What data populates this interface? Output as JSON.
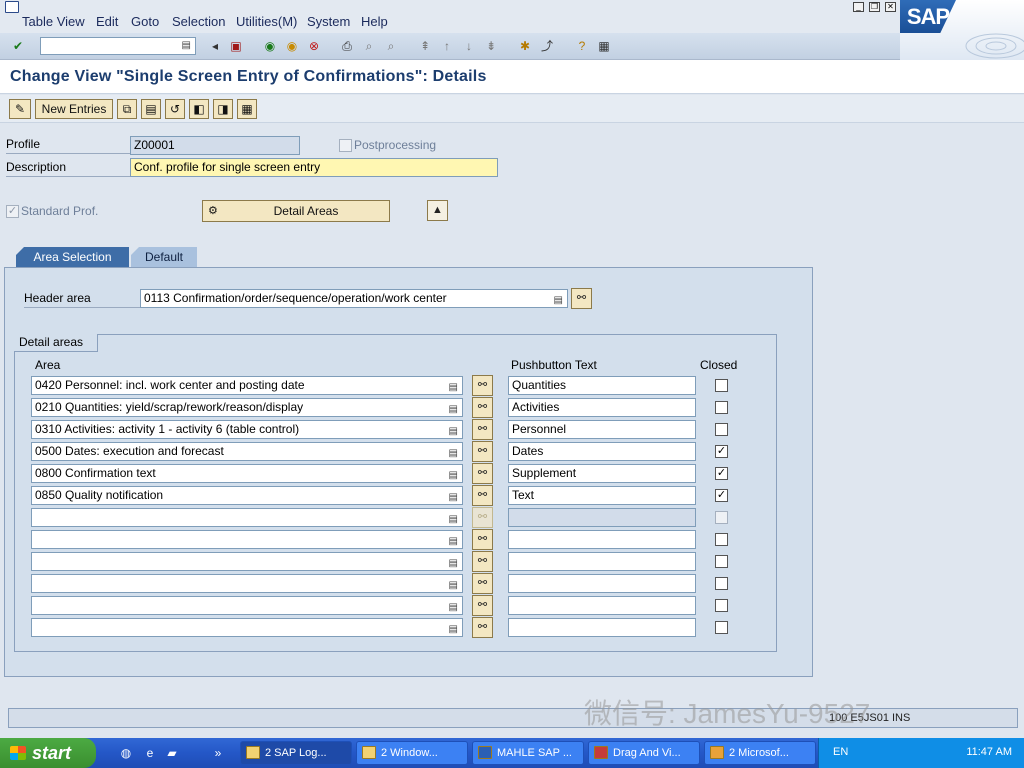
{
  "menu": {
    "items": [
      "Table View",
      "Edit",
      "Goto",
      "Selection",
      "Utilities(M)",
      "System",
      "Help"
    ],
    "underline_first": [
      "T",
      "E",
      "G",
      "S",
      "U",
      "S",
      "H"
    ]
  },
  "logo": {
    "text": "SAP"
  },
  "title": "Change View \"Single Screen Entry of Confirmations\": Details",
  "app_toolbar": {
    "new_entries": "New Entries"
  },
  "form": {
    "profile_label": "Profile",
    "profile_value": "Z00001",
    "postprocessing_label": "Postprocessing",
    "description_label": "Description",
    "description_value": "Conf. profile for single screen entry",
    "standard_prof_label": "Standard Prof.",
    "detail_areas_button": "Detail Areas"
  },
  "tabs": [
    "Area Selection",
    "Default"
  ],
  "header_area": {
    "label": "Header area",
    "value": "0113 Confirmation/order/sequence/operation/work center"
  },
  "detail_areas": {
    "group_title": "Detail areas",
    "columns": {
      "area": "Area",
      "pushbutton_text": "Pushbutton Text",
      "closed": "Closed"
    },
    "rows": [
      {
        "area": "0420 Personnel: incl. work center and posting date",
        "text": "Quantities",
        "closed": false
      },
      {
        "area": "0210 Quantities: yield/scrap/rework/reason/display",
        "text": "Activities",
        "closed": false
      },
      {
        "area": "0310 Activities: activity 1 - activity 6 (table control)",
        "text": "Personnel",
        "closed": false
      },
      {
        "area": "0500 Dates: execution and forecast",
        "text": "Dates",
        "closed": true
      },
      {
        "area": "0800 Confirmation text",
        "text": "Supplement",
        "closed": true
      },
      {
        "area": "0850 Quality notification",
        "text": "Text",
        "closed": true
      },
      {
        "area": "",
        "text": "",
        "closed": false,
        "disabled": true
      },
      {
        "area": "",
        "text": "",
        "closed": false
      },
      {
        "area": "",
        "text": "",
        "closed": false
      },
      {
        "area": "",
        "text": "",
        "closed": false
      },
      {
        "area": "",
        "text": "",
        "closed": false
      },
      {
        "area": "",
        "text": "",
        "closed": false
      }
    ]
  },
  "status_bar": {
    "info": "100 E5JS01 INS"
  },
  "watermark": "微信号: JamesYu-9527",
  "taskbar": {
    "start": "start",
    "buttons": [
      "2 SAP Log...",
      "2 Window...",
      "MAHLE SAP ...",
      "Drag And Vi...",
      "2 Microsof..."
    ],
    "lang": "EN",
    "clock": "11:47 AM"
  }
}
